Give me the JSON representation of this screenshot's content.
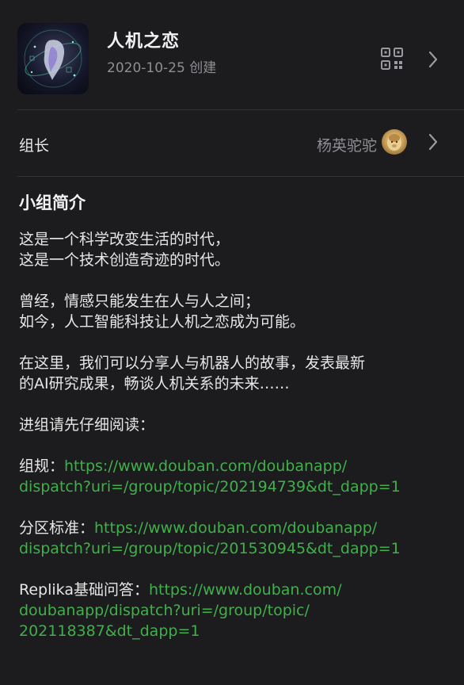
{
  "group": {
    "title": "人机之恋",
    "created": "2020-10-25 创建"
  },
  "owner": {
    "label": "组长",
    "name": "杨英驼驼"
  },
  "intro": {
    "title": "小组简介",
    "p1_l1": "这是一个科学改变生活的时代，",
    "p1_l2": "这是一个技术创造奇迹的时代。",
    "p2_l1": "曾经，情感只能发生在人与人之间；",
    "p2_l2": "如今，人工智能科技让人机之恋成为可能。",
    "p3_l1": "在这里，我们可以分享人与机器人的故事，发表最新",
    "p3_l2": "的AI研究成果，畅谈人机关系的未来……",
    "p4": "进组请先仔细阅读：",
    "rule_label": "组规：",
    "rule_link_l1": "https://www.douban.com/doubanapp/",
    "rule_link_l2": "dispatch?uri=/group/topic/202194739&dt_dapp=1",
    "zone_label": "分区标准：",
    "zone_link_l1": "https://www.douban.com/doubanapp/",
    "zone_link_l2": "dispatch?uri=/group/topic/201530945&dt_dapp=1",
    "faq_label": "Replika基础问答：",
    "faq_link_l1": "https://www.douban.com/",
    "faq_link_l2": "doubanapp/dispatch?uri=/group/topic/",
    "faq_link_l3": "202118387&dt_dapp=1"
  },
  "icons": {
    "qr": "qr-code-icon",
    "chevron": "chevron-right-icon"
  },
  "colors": {
    "background": "#1c1c1e",
    "link": "#3fb04a",
    "secondary_text": "#8e8e93"
  }
}
